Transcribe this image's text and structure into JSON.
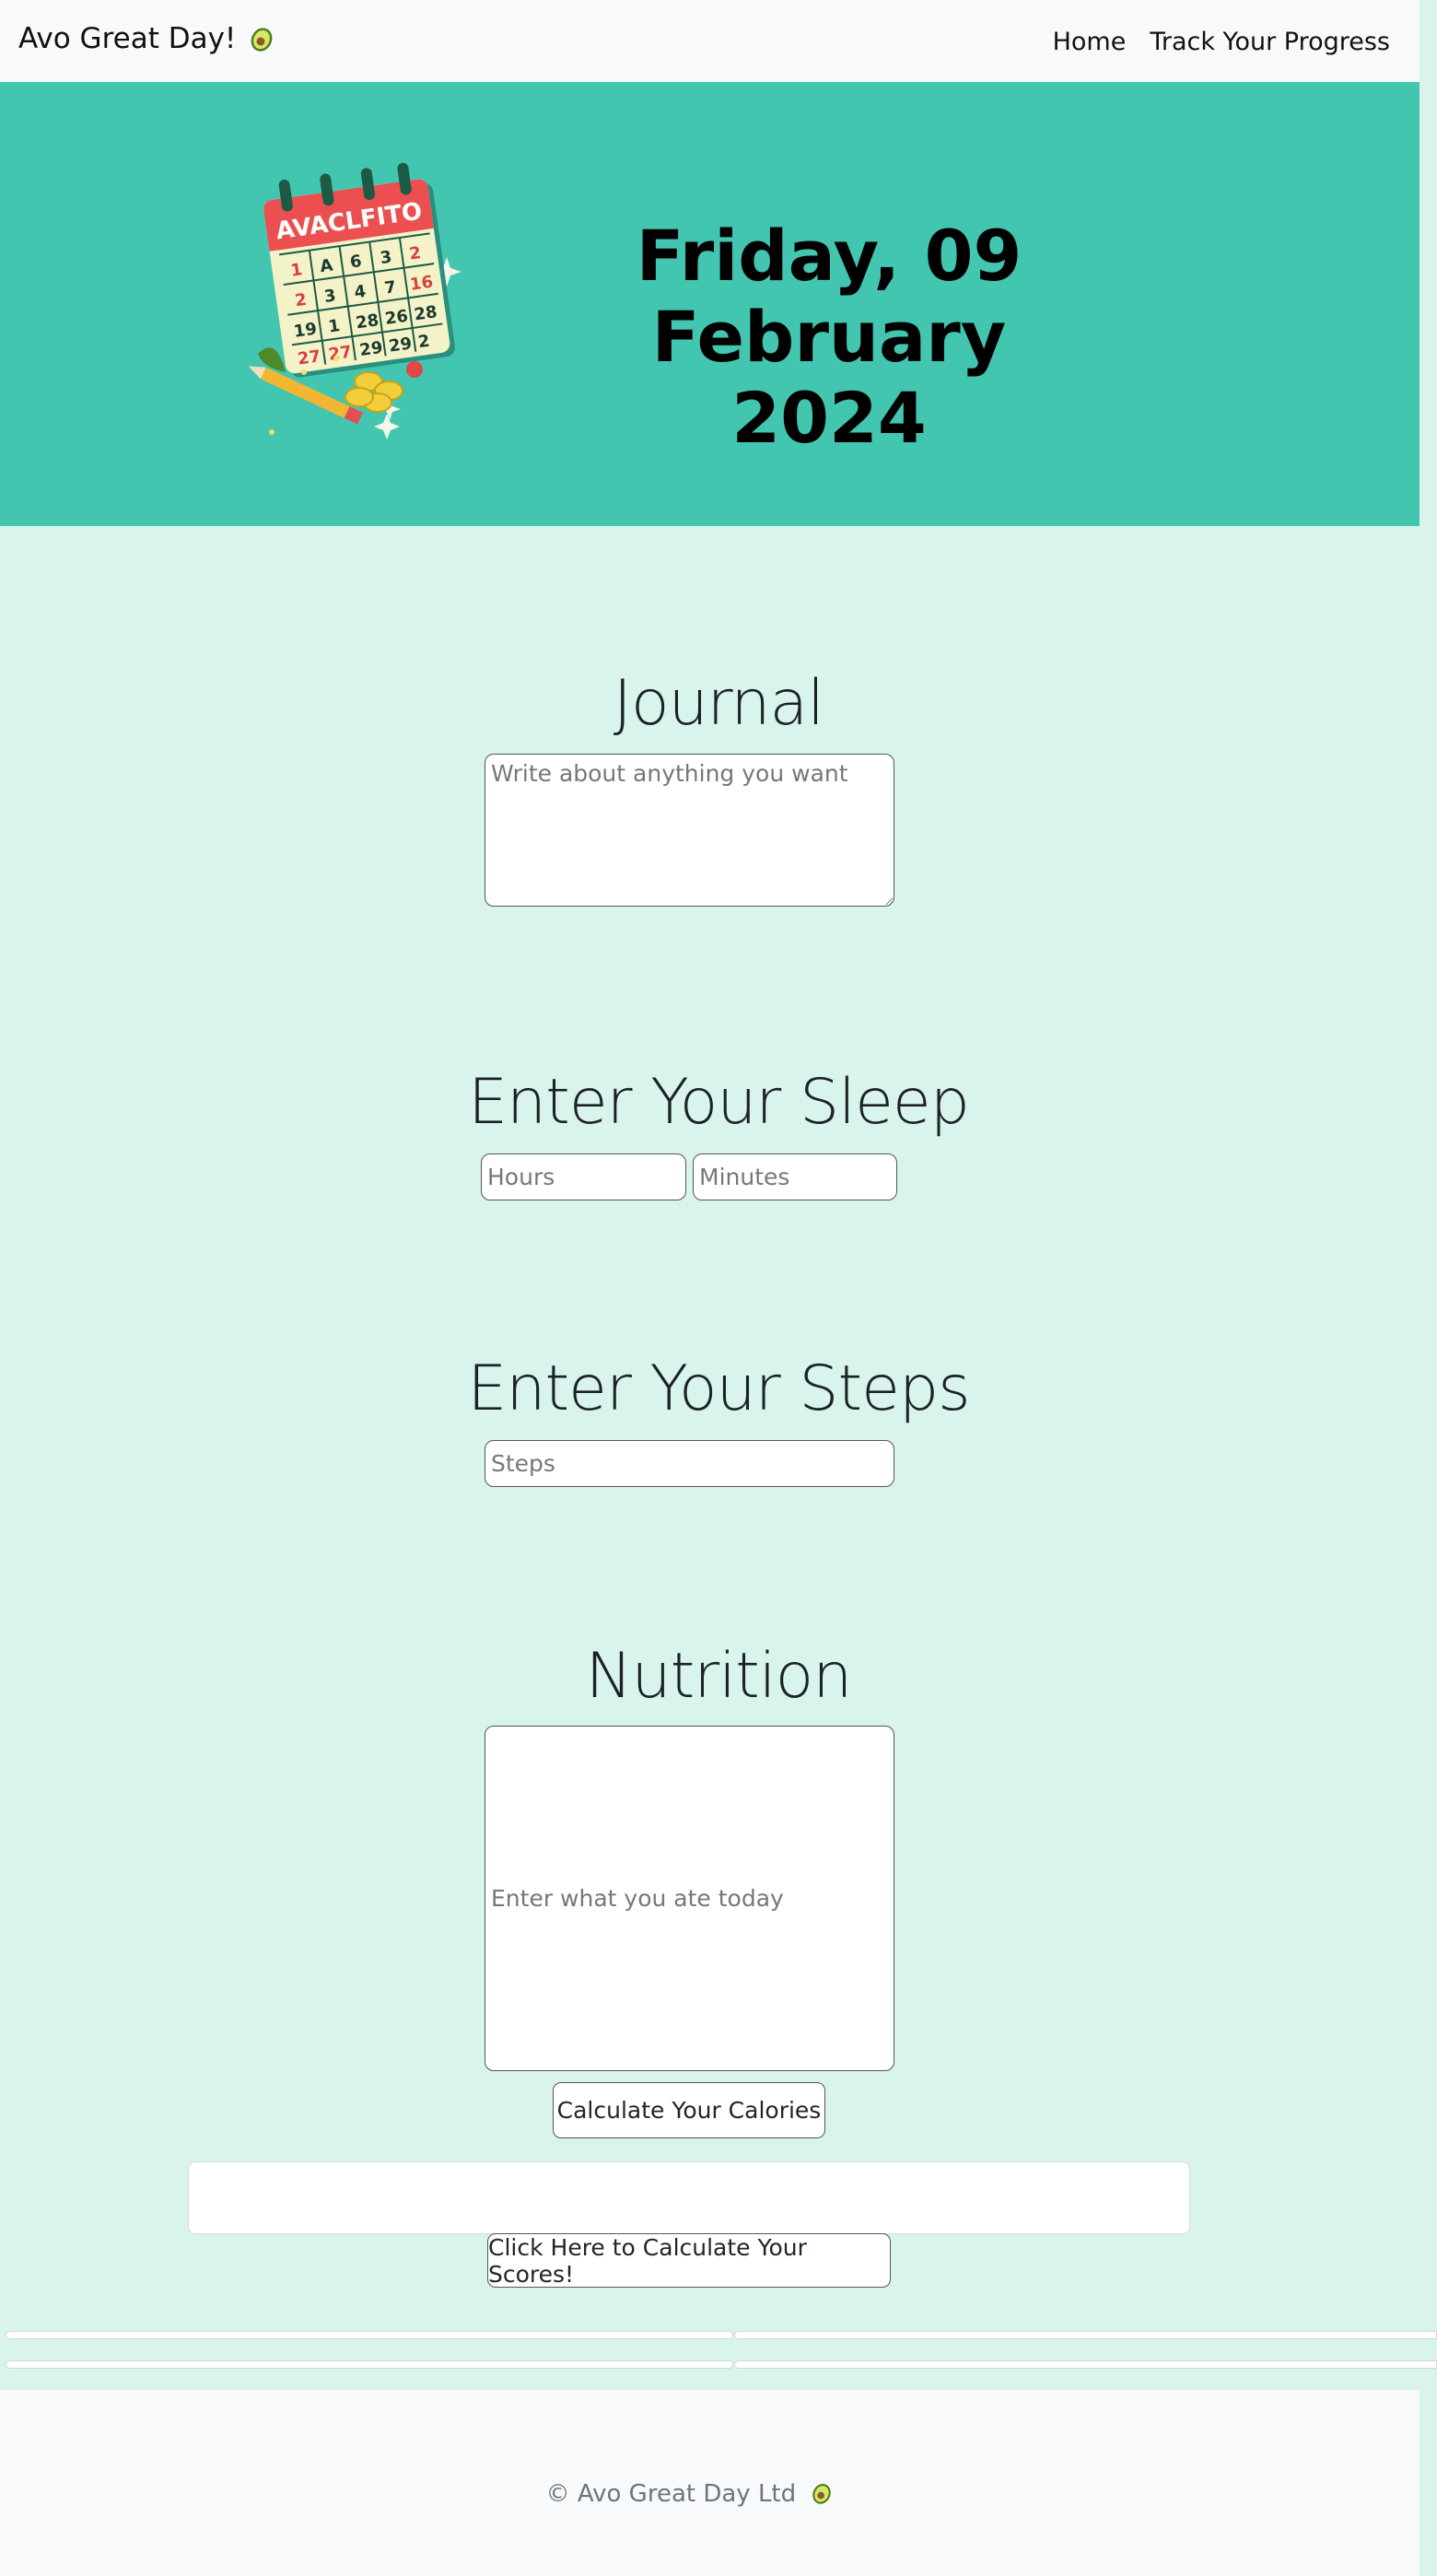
{
  "navbar": {
    "brand": "Avo Great Day!",
    "brand_icon": "avocado-icon",
    "links": [
      "Home",
      "Track Your Progress"
    ]
  },
  "hero": {
    "date_line1": "Friday, 09 February",
    "date_line2": "2024",
    "illustration": "calendar-illustration",
    "calendar_brand": "AVACLFITO",
    "background": "#43c6b0"
  },
  "journal": {
    "title": "Journal",
    "placeholder": "Write about anything you want"
  },
  "sleep": {
    "title": "Enter Your Sleep",
    "hours_placeholder": "Hours",
    "minutes_placeholder": "Minutes"
  },
  "steps": {
    "title": "Enter Your Steps",
    "placeholder": "Steps"
  },
  "nutrition": {
    "title": "Nutrition",
    "placeholder": "Enter what you ate today",
    "calories_button": "Calculate Your Calories",
    "result": "",
    "scores_button": "Click Here to Calculate Your Scores!"
  },
  "footer": {
    "text": "© Avo Great Day Ltd",
    "icon": "avocado-icon"
  },
  "colors": {
    "page_background": "#d9f3ed",
    "hero_background": "#43c6b0",
    "navbar_background": "#f8f9fa"
  }
}
